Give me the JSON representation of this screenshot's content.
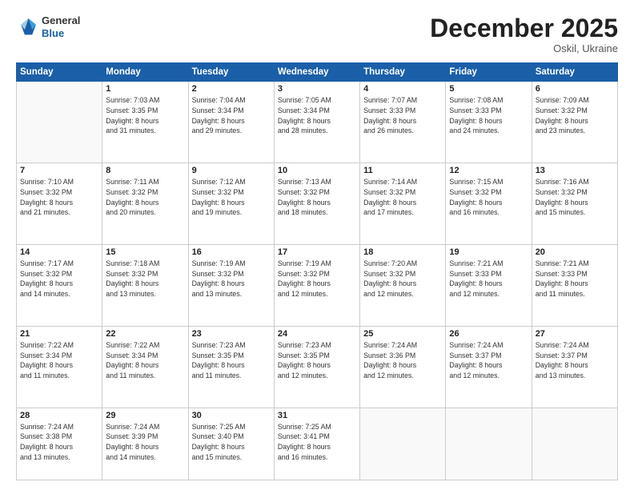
{
  "header": {
    "logo_line1": "General",
    "logo_line2": "Blue",
    "month": "December 2025",
    "location": "Oskil, Ukraine"
  },
  "weekdays": [
    "Sunday",
    "Monday",
    "Tuesday",
    "Wednesday",
    "Thursday",
    "Friday",
    "Saturday"
  ],
  "weeks": [
    [
      {
        "num": "",
        "info": ""
      },
      {
        "num": "1",
        "info": "Sunrise: 7:03 AM\nSunset: 3:35 PM\nDaylight: 8 hours\nand 31 minutes."
      },
      {
        "num": "2",
        "info": "Sunrise: 7:04 AM\nSunset: 3:34 PM\nDaylight: 8 hours\nand 29 minutes."
      },
      {
        "num": "3",
        "info": "Sunrise: 7:05 AM\nSunset: 3:34 PM\nDaylight: 8 hours\nand 28 minutes."
      },
      {
        "num": "4",
        "info": "Sunrise: 7:07 AM\nSunset: 3:33 PM\nDaylight: 8 hours\nand 26 minutes."
      },
      {
        "num": "5",
        "info": "Sunrise: 7:08 AM\nSunset: 3:33 PM\nDaylight: 8 hours\nand 24 minutes."
      },
      {
        "num": "6",
        "info": "Sunrise: 7:09 AM\nSunset: 3:32 PM\nDaylight: 8 hours\nand 23 minutes."
      }
    ],
    [
      {
        "num": "7",
        "info": "Sunrise: 7:10 AM\nSunset: 3:32 PM\nDaylight: 8 hours\nand 21 minutes."
      },
      {
        "num": "8",
        "info": "Sunrise: 7:11 AM\nSunset: 3:32 PM\nDaylight: 8 hours\nand 20 minutes."
      },
      {
        "num": "9",
        "info": "Sunrise: 7:12 AM\nSunset: 3:32 PM\nDaylight: 8 hours\nand 19 minutes."
      },
      {
        "num": "10",
        "info": "Sunrise: 7:13 AM\nSunset: 3:32 PM\nDaylight: 8 hours\nand 18 minutes."
      },
      {
        "num": "11",
        "info": "Sunrise: 7:14 AM\nSunset: 3:32 PM\nDaylight: 8 hours\nand 17 minutes."
      },
      {
        "num": "12",
        "info": "Sunrise: 7:15 AM\nSunset: 3:32 PM\nDaylight: 8 hours\nand 16 minutes."
      },
      {
        "num": "13",
        "info": "Sunrise: 7:16 AM\nSunset: 3:32 PM\nDaylight: 8 hours\nand 15 minutes."
      }
    ],
    [
      {
        "num": "14",
        "info": "Sunrise: 7:17 AM\nSunset: 3:32 PM\nDaylight: 8 hours\nand 14 minutes."
      },
      {
        "num": "15",
        "info": "Sunrise: 7:18 AM\nSunset: 3:32 PM\nDaylight: 8 hours\nand 13 minutes."
      },
      {
        "num": "16",
        "info": "Sunrise: 7:19 AM\nSunset: 3:32 PM\nDaylight: 8 hours\nand 13 minutes."
      },
      {
        "num": "17",
        "info": "Sunrise: 7:19 AM\nSunset: 3:32 PM\nDaylight: 8 hours\nand 12 minutes."
      },
      {
        "num": "18",
        "info": "Sunrise: 7:20 AM\nSunset: 3:32 PM\nDaylight: 8 hours\nand 12 minutes."
      },
      {
        "num": "19",
        "info": "Sunrise: 7:21 AM\nSunset: 3:33 PM\nDaylight: 8 hours\nand 12 minutes."
      },
      {
        "num": "20",
        "info": "Sunrise: 7:21 AM\nSunset: 3:33 PM\nDaylight: 8 hours\nand 11 minutes."
      }
    ],
    [
      {
        "num": "21",
        "info": "Sunrise: 7:22 AM\nSunset: 3:34 PM\nDaylight: 8 hours\nand 11 minutes."
      },
      {
        "num": "22",
        "info": "Sunrise: 7:22 AM\nSunset: 3:34 PM\nDaylight: 8 hours\nand 11 minutes."
      },
      {
        "num": "23",
        "info": "Sunrise: 7:23 AM\nSunset: 3:35 PM\nDaylight: 8 hours\nand 11 minutes."
      },
      {
        "num": "24",
        "info": "Sunrise: 7:23 AM\nSunset: 3:35 PM\nDaylight: 8 hours\nand 12 minutes."
      },
      {
        "num": "25",
        "info": "Sunrise: 7:24 AM\nSunset: 3:36 PM\nDaylight: 8 hours\nand 12 minutes."
      },
      {
        "num": "26",
        "info": "Sunrise: 7:24 AM\nSunset: 3:37 PM\nDaylight: 8 hours\nand 12 minutes."
      },
      {
        "num": "27",
        "info": "Sunrise: 7:24 AM\nSunset: 3:37 PM\nDaylight: 8 hours\nand 13 minutes."
      }
    ],
    [
      {
        "num": "28",
        "info": "Sunrise: 7:24 AM\nSunset: 3:38 PM\nDaylight: 8 hours\nand 13 minutes."
      },
      {
        "num": "29",
        "info": "Sunrise: 7:24 AM\nSunset: 3:39 PM\nDaylight: 8 hours\nand 14 minutes."
      },
      {
        "num": "30",
        "info": "Sunrise: 7:25 AM\nSunset: 3:40 PM\nDaylight: 8 hours\nand 15 minutes."
      },
      {
        "num": "31",
        "info": "Sunrise: 7:25 AM\nSunset: 3:41 PM\nDaylight: 8 hours\nand 16 minutes."
      },
      {
        "num": "",
        "info": ""
      },
      {
        "num": "",
        "info": ""
      },
      {
        "num": "",
        "info": ""
      }
    ]
  ]
}
